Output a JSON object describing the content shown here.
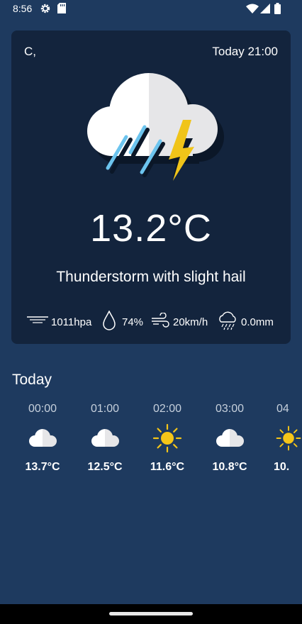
{
  "status_bar": {
    "time": "8:56",
    "left_icons": [
      "gear-icon",
      "sd-card-icon"
    ],
    "right_icons": [
      "wifi-icon",
      "signal-icon",
      "battery-icon"
    ]
  },
  "current": {
    "location": "C,",
    "time_label": "Today 21:00",
    "icon": "thunderstorm-hail-icon",
    "temperature": "13.2°C",
    "description": "Thunderstorm with slight hail",
    "pressure": "1011hpa",
    "humidity": "74%",
    "wind": "20km/h",
    "precipitation": "0.0mm"
  },
  "hourly": {
    "title": "Today",
    "items": [
      {
        "time": "00:00",
        "icon": "cloud-icon",
        "temp": "13.7°C"
      },
      {
        "time": "01:00",
        "icon": "cloud-icon",
        "temp": "12.5°C"
      },
      {
        "time": "02:00",
        "icon": "sun-icon",
        "temp": "11.6°C"
      },
      {
        "time": "03:00",
        "icon": "cloud-icon",
        "temp": "10.8°C"
      },
      {
        "time": "04",
        "icon": "sun-icon",
        "temp": "10."
      }
    ]
  },
  "colors": {
    "background": "#1e3a5f",
    "card": "#13243d",
    "sun": "#f5c518",
    "bolt": "#f0c419",
    "rain": "#6cc4ee"
  }
}
